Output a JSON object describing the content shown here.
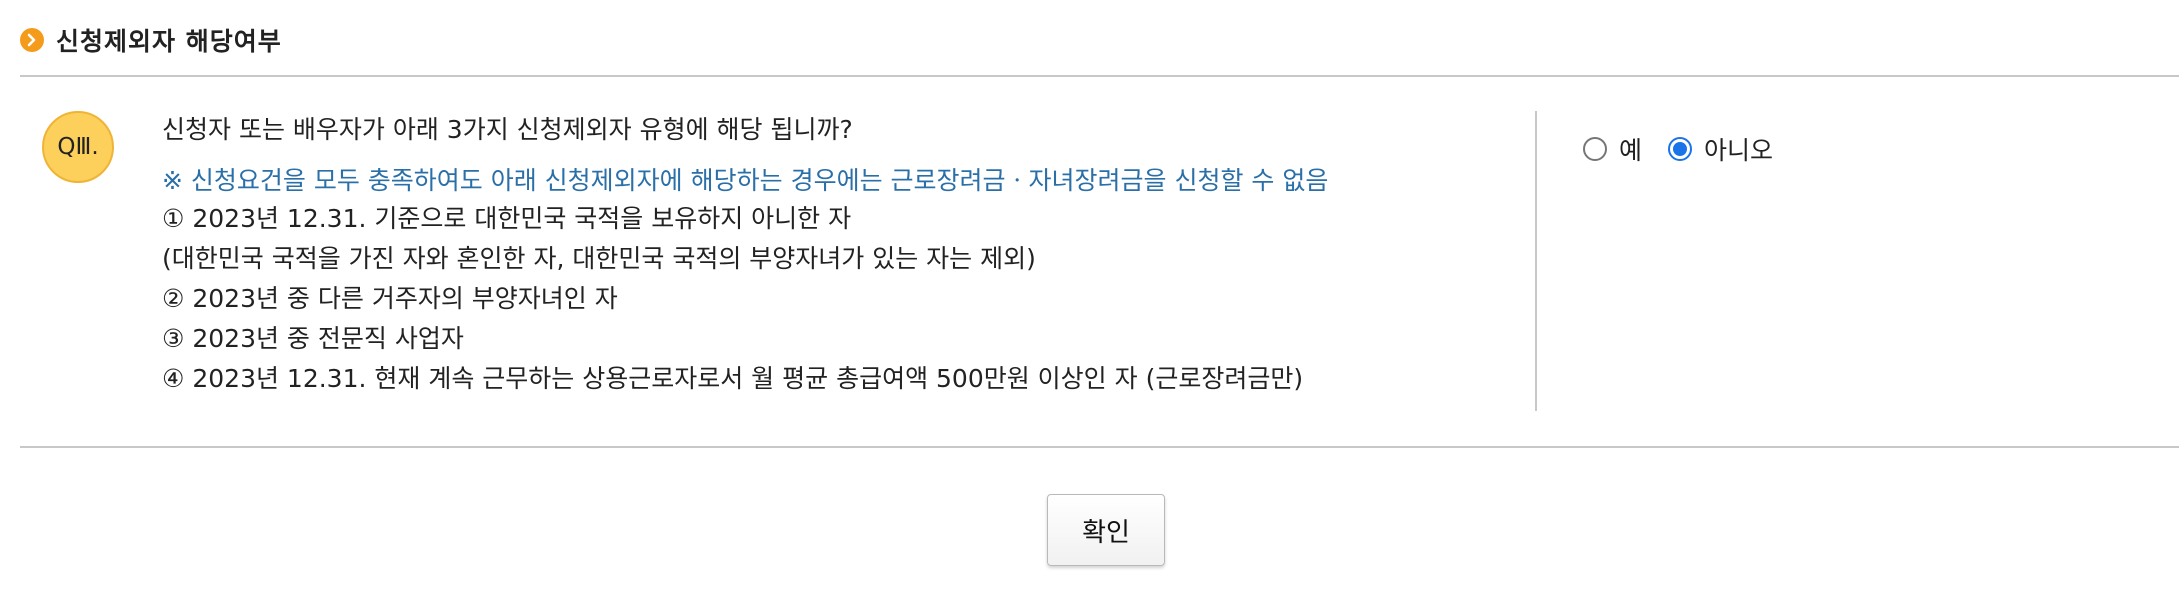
{
  "section": {
    "title": "신청제외자 해당여부",
    "icon": "chevron-right-circle-icon",
    "icon_color": "#f59b1c"
  },
  "question": {
    "badge": "QⅢ.",
    "badge_color": "#fcd05a",
    "text": "신청자 또는 배우자가 아래 3가지 신청제외자 유형에 해당 됩니까?",
    "notice": "※ 신청요건을 모두 충족하여도 아래 신청제외자에 해당하는 경우에는 근로장려금ㆍ자녀장려금을 신청할 수 없음",
    "notice_color": "#2a6fa8",
    "conditions": [
      "① 2023년 12.31. 기준으로 대한민국 국적을 보유하지 아니한 자",
      "(대한민국 국적을 가진 자와 혼인한 자, 대한민국 국적의 부양자녀가 있는 자는 제외)",
      "② 2023년 중 다른 거주자의 부양자녀인 자",
      "③ 2023년 중 전문직 사업자",
      "④ 2023년 12.31. 현재 계속 근무하는 상용근로자로서 월 평균 총급여액 500만원 이상인 자 (근로장려금만)"
    ]
  },
  "answer": {
    "options": [
      {
        "label": "예",
        "checked": false
      },
      {
        "label": "아니오",
        "checked": true
      }
    ],
    "selected": "아니오",
    "accent_color": "#1a73e8"
  },
  "footer": {
    "confirm_label": "확인"
  }
}
